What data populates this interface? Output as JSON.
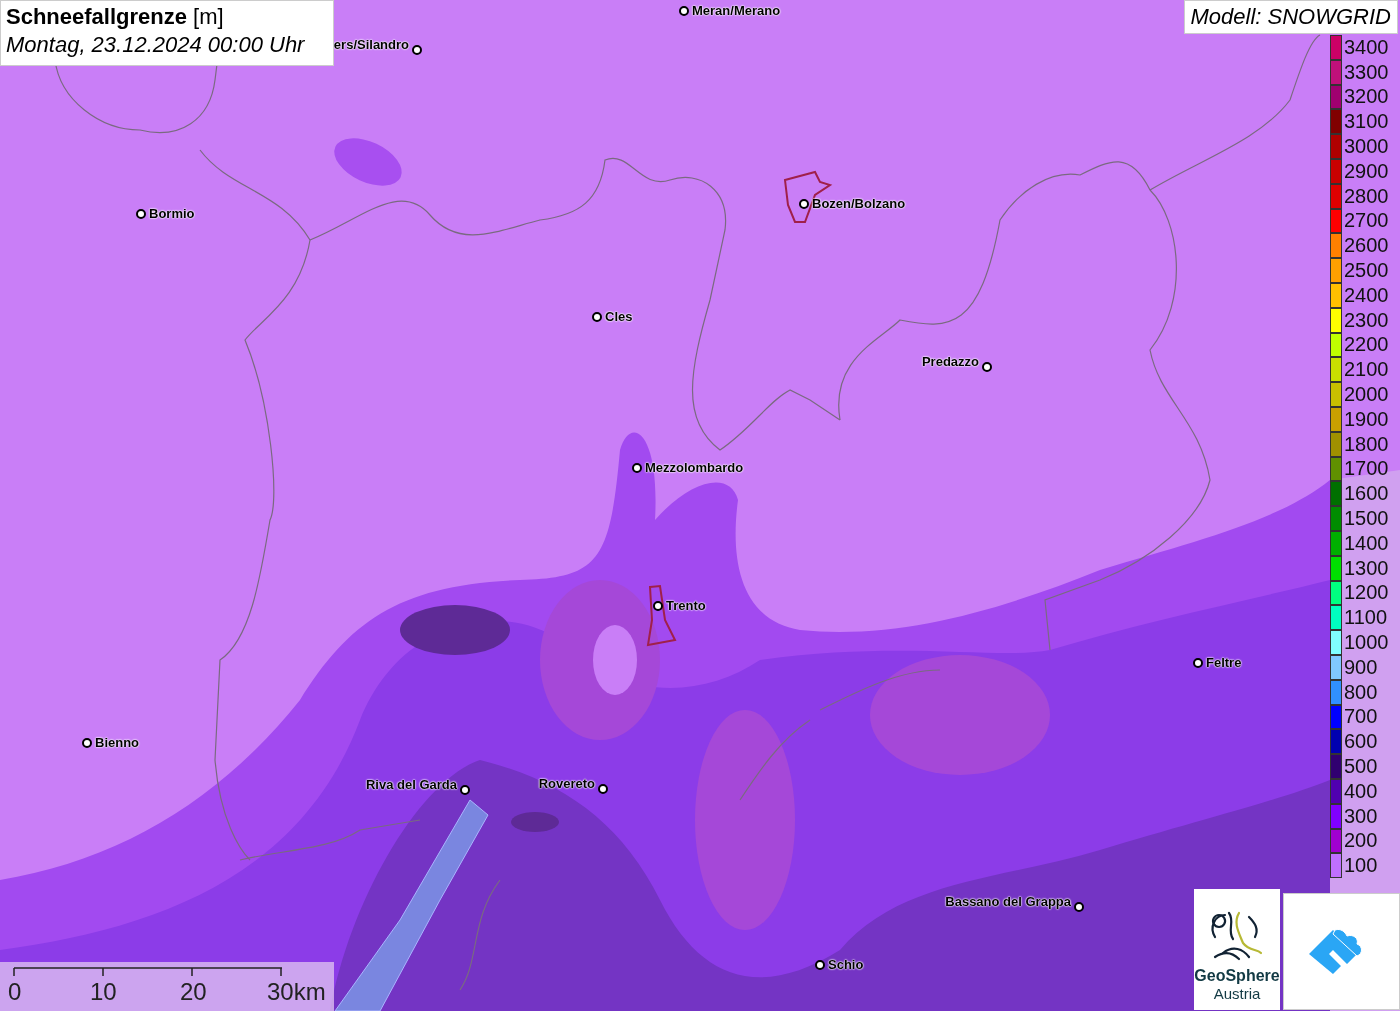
{
  "title": {
    "parameter": "Schneefallgrenze",
    "unit": "[m]",
    "datetime": "Montag, 23.12.2024 00:00 Uhr"
  },
  "model": "Modell: SNOWGRID",
  "cities": [
    {
      "label": "Meran/Merano"
    },
    {
      "label": "ers/Silandro"
    },
    {
      "label": "Bormio"
    },
    {
      "label": "Bozen/Bolzano"
    },
    {
      "label": "Cles"
    },
    {
      "label": "Predazzo"
    },
    {
      "label": "Mezzolombardo"
    },
    {
      "label": "Trento"
    },
    {
      "label": "Feltre"
    },
    {
      "label": "Bienno"
    },
    {
      "label": "Riva del Garda"
    },
    {
      "label": "Rovereto"
    },
    {
      "label": "Bassano del Grappa"
    },
    {
      "label": "Schio"
    }
  ],
  "legend": [
    {
      "label": "3400",
      "color": "#cc0066"
    },
    {
      "label": "3300",
      "color": "#c0107a"
    },
    {
      "label": "3200",
      "color": "#a00070"
    },
    {
      "label": "3100",
      "color": "#800000"
    },
    {
      "label": "3000",
      "color": "#b00000"
    },
    {
      "label": "2900",
      "color": "#c80000"
    },
    {
      "label": "2800",
      "color": "#e00000"
    },
    {
      "label": "2700",
      "color": "#ff0000"
    },
    {
      "label": "2600",
      "color": "#ff8000"
    },
    {
      "label": "2500",
      "color": "#ffa000"
    },
    {
      "label": "2400",
      "color": "#ffc000"
    },
    {
      "label": "2300",
      "color": "#ffff00"
    },
    {
      "label": "2200",
      "color": "#c0ff00"
    },
    {
      "label": "2100",
      "color": "#c8e000"
    },
    {
      "label": "2000",
      "color": "#c8c000"
    },
    {
      "label": "1900",
      "color": "#c8a000"
    },
    {
      "label": "1800",
      "color": "#a09000"
    },
    {
      "label": "1700",
      "color": "#609000"
    },
    {
      "label": "1600",
      "color": "#007000"
    },
    {
      "label": "1500",
      "color": "#008c00"
    },
    {
      "label": "1400",
      "color": "#00b000"
    },
    {
      "label": "1300",
      "color": "#00e000"
    },
    {
      "label": "1200",
      "color": "#00ff80"
    },
    {
      "label": "1100",
      "color": "#00ffc0"
    },
    {
      "label": "1000",
      "color": "#80ffff"
    },
    {
      "label": "900",
      "color": "#80c8ff"
    },
    {
      "label": "800",
      "color": "#3090ff"
    },
    {
      "label": "700",
      "color": "#0000ff"
    },
    {
      "label": "600",
      "color": "#0000b0"
    },
    {
      "label": "500",
      "color": "#300070"
    },
    {
      "label": "400",
      "color": "#5000b0"
    },
    {
      "label": "300",
      "color": "#8000ff"
    },
    {
      "label": "200",
      "color": "#a000d0"
    },
    {
      "label": "100",
      "color": "#c070ff"
    }
  ],
  "scale_bar": {
    "labels": [
      "0",
      "10",
      "20",
      "30km"
    ]
  },
  "logo": {
    "name": "GeoSphere",
    "country": "Austria"
  }
}
